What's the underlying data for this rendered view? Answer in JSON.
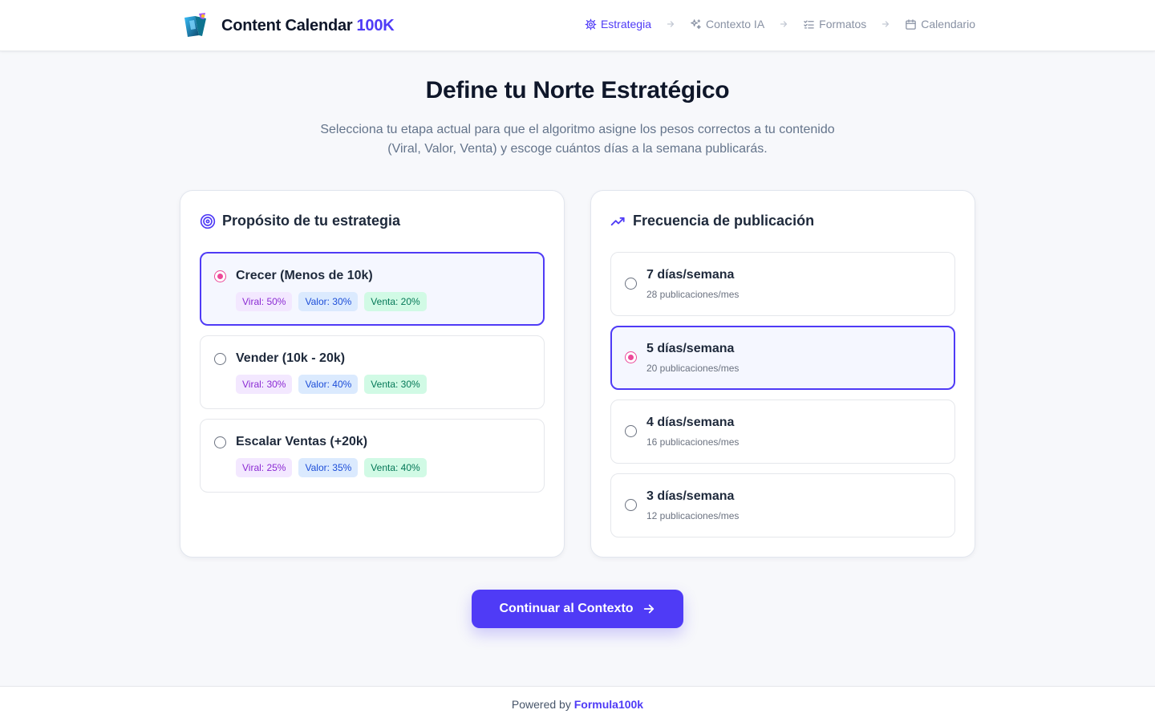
{
  "header": {
    "title": "Content Calendar",
    "title_accent": "100K",
    "steps": [
      {
        "label": "Estrategia",
        "icon": "gear-icon",
        "active": true
      },
      {
        "label": "Contexto IA",
        "icon": "sparkles-icon",
        "active": false
      },
      {
        "label": "Formatos",
        "icon": "checklist-icon",
        "active": false
      },
      {
        "label": "Calendario",
        "icon": "calendar-icon",
        "active": false
      }
    ]
  },
  "main": {
    "title": "Define tu Norte Estratégico",
    "subtitle": "Selecciona tu etapa actual para que el algoritmo asigne los pesos correctos a tu contenido (Viral, Valor, Venta) y escoge cuántos días a la semana publicarás."
  },
  "purpose": {
    "title": "Propósito de tu estrategia",
    "options": [
      {
        "label": "Crecer (Menos de 10k)",
        "selected": true,
        "tags": [
          "Viral: 50%",
          "Valor: 30%",
          "Venta: 20%"
        ]
      },
      {
        "label": "Vender (10k - 20k)",
        "selected": false,
        "tags": [
          "Viral: 30%",
          "Valor: 40%",
          "Venta: 30%"
        ]
      },
      {
        "label": "Escalar Ventas (+20k)",
        "selected": false,
        "tags": [
          "Viral: 25%",
          "Valor: 35%",
          "Venta: 40%"
        ]
      }
    ]
  },
  "frequency": {
    "title": "Frecuencia de publicación",
    "options": [
      {
        "label": "7 días/semana",
        "sub": "28 publicaciones/mes",
        "selected": false
      },
      {
        "label": "5 días/semana",
        "sub": "20 publicaciones/mes",
        "selected": true
      },
      {
        "label": "4 días/semana",
        "sub": "16 publicaciones/mes",
        "selected": false
      },
      {
        "label": "3 días/semana",
        "sub": "12 publicaciones/mes",
        "selected": false
      }
    ]
  },
  "cta": {
    "label": "Continuar al Contexto"
  },
  "footer": {
    "prefix": "Powered by",
    "link": "Formula100k"
  },
  "colors": {
    "accent": "#4f3bf6",
    "radio": "#ec4899",
    "viral": "#8b2bd3",
    "valor": "#1d4ed8",
    "venta": "#047857"
  }
}
